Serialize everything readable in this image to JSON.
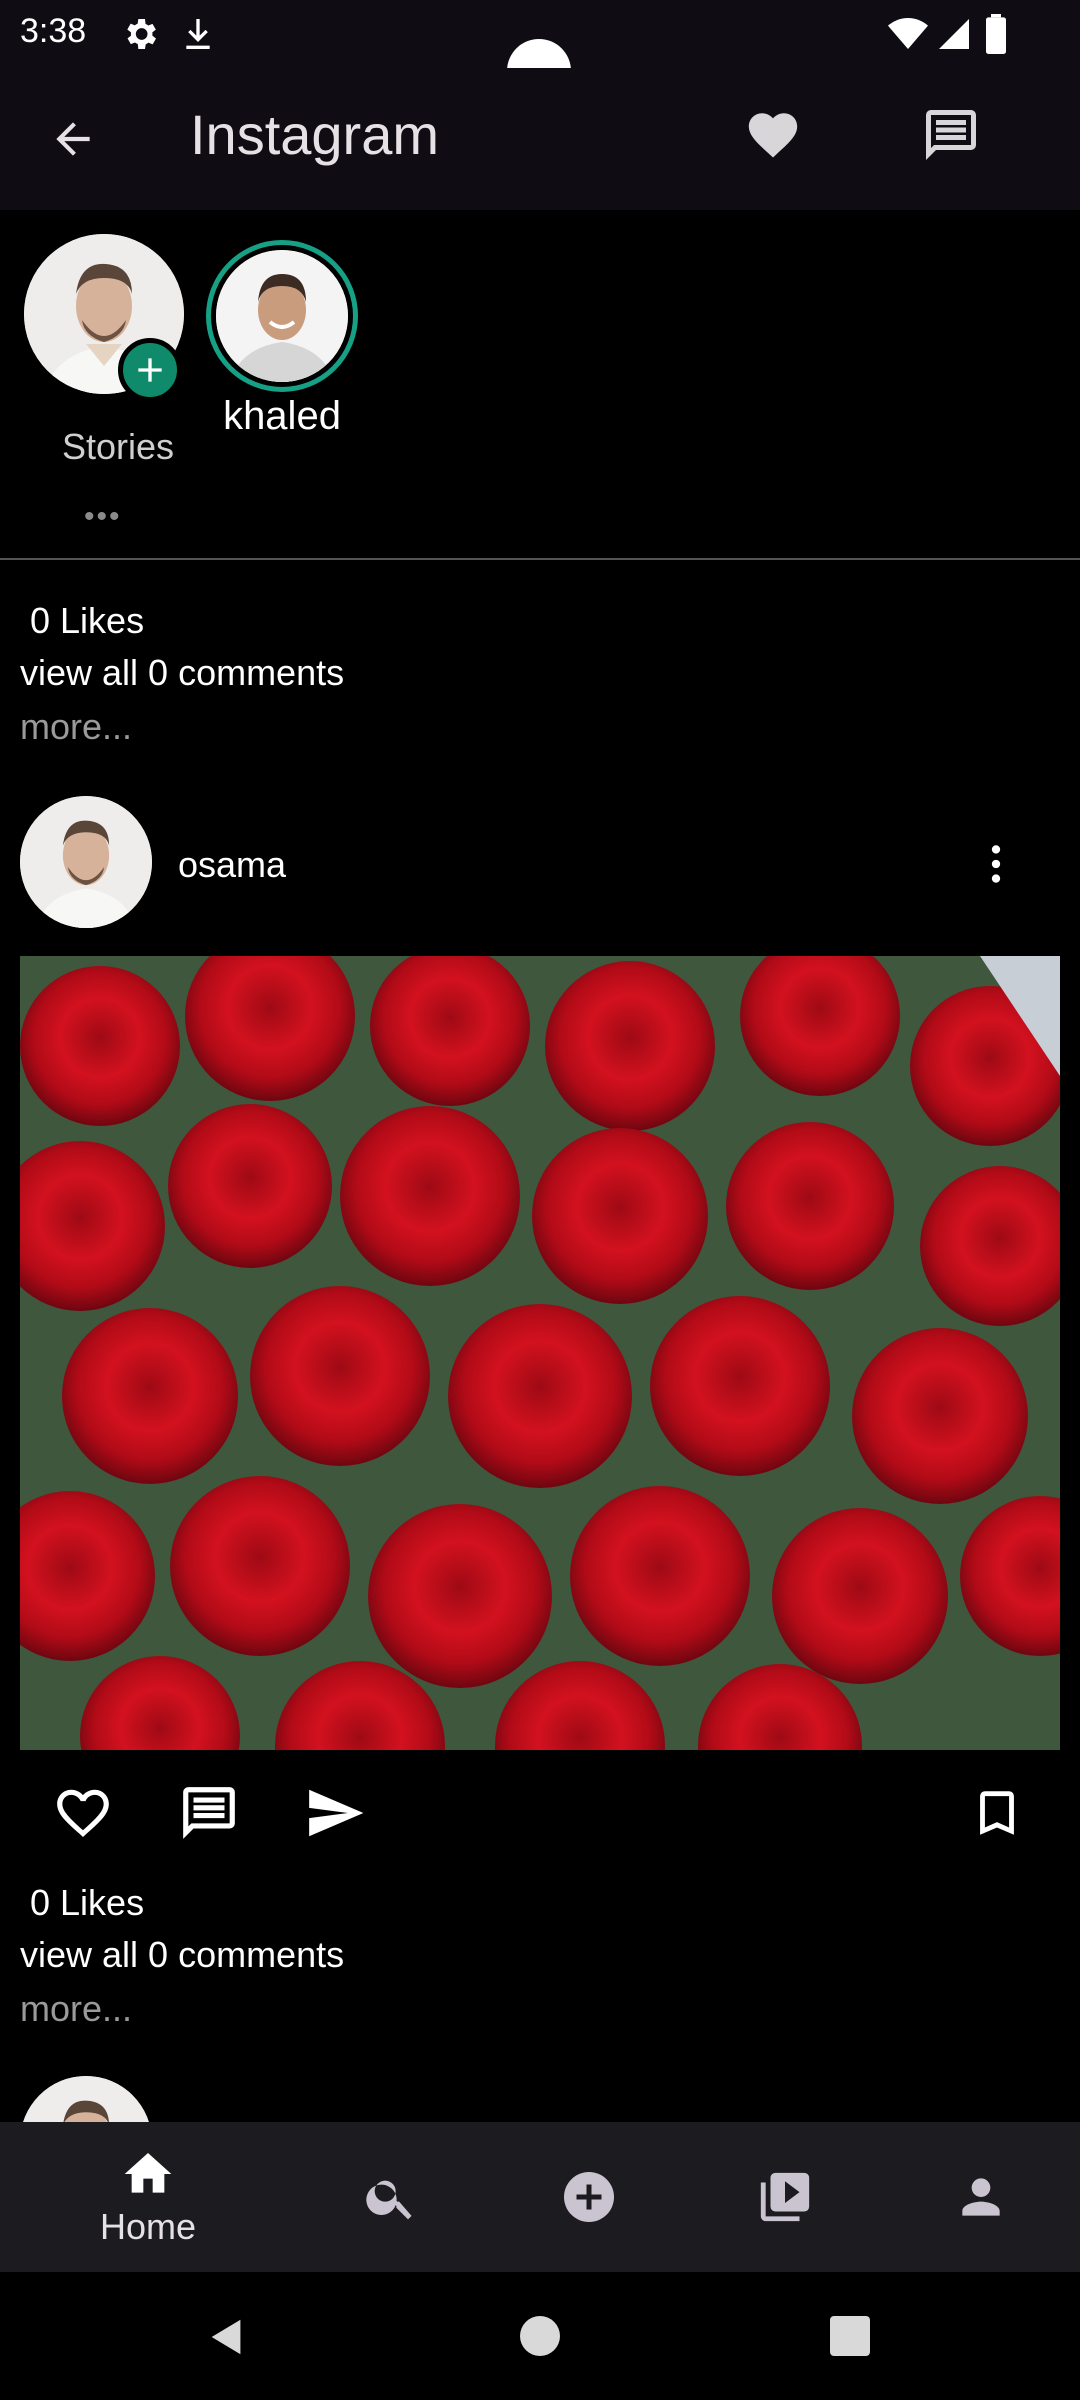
{
  "status_bar": {
    "time": "3:38",
    "icons": [
      "settings-icon",
      "download-icon",
      "wifi-icon",
      "signal-icon",
      "battery-icon"
    ]
  },
  "app_bar": {
    "title": "Instagram",
    "icons": [
      "back-arrow-icon",
      "heart-icon",
      "message-icon"
    ]
  },
  "stories": {
    "own_label": "Stories",
    "own_dots": "•••",
    "users": [
      {
        "name": "khaled"
      }
    ]
  },
  "posts": [
    {
      "likes": "0 Likes",
      "comments": "view all 0 comments",
      "more": "more..."
    },
    {
      "user": "osama",
      "likes": "0 Likes",
      "comments": "view all 0 comments",
      "more": "more..."
    }
  ],
  "bottom_nav": {
    "items": [
      {
        "label": "Home",
        "icon": "home-icon",
        "active": true
      },
      {
        "label": "",
        "icon": "search-icon"
      },
      {
        "label": "",
        "icon": "add-circle-icon"
      },
      {
        "label": "",
        "icon": "video-library-icon"
      },
      {
        "label": "",
        "icon": "person-icon"
      }
    ]
  },
  "colors": {
    "appbar": "#0f0d13",
    "story_ring": "#16a085",
    "plus_badge": "#0f8a6b",
    "navbar": "#1c1b1f"
  }
}
